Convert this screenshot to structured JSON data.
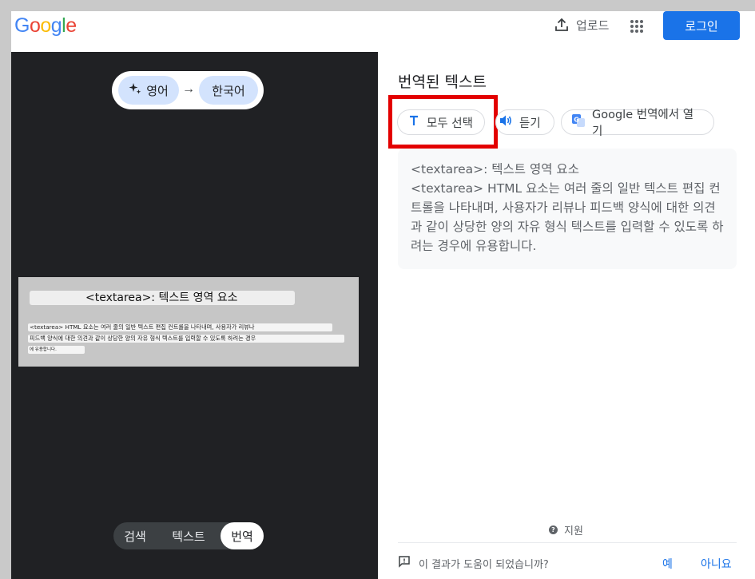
{
  "header": {
    "logo_letters": [
      "G",
      "o",
      "o",
      "g",
      "l",
      "e"
    ],
    "logo_colors": [
      "#4285F4",
      "#EA4335",
      "#FBBC05",
      "#4285F4",
      "#34A853",
      "#EA4335"
    ],
    "upload_label": "업로드",
    "upload_icon": "upload-icon",
    "apps_icon": "apps-grid-icon",
    "login_label": "로그인"
  },
  "left_panel": {
    "source_language": "영어",
    "target_language": "한국어",
    "swap_arrow": "→",
    "source_icon": "sparkle-icon",
    "preview": {
      "title_text": "<textarea>: 텍스트 영역 요소",
      "body_lines": [
        "<textarea> HTML 요소는 여러 줄의 일반 텍스트 편집 컨트롤을 나타내며, 사용자가 리뷰나",
        "피드백 양식에 대한 의견과 같이 상당한 양의 자유 형식 텍스트를 입력할 수 있도록 하려는 경우",
        "에 유용합니다."
      ]
    },
    "modes": [
      "검색",
      "텍스트",
      "번역"
    ],
    "active_mode": "번역"
  },
  "right_panel": {
    "title": "번역된 텍스트",
    "select_all_label": "모두 선택",
    "listen_label": "듣기",
    "open_in_translate_label": "Google 번역에서 열기",
    "highlight_color": "#e30000",
    "result_lines": [
      "<textarea>: 텍스트 영역 요소",
      "<textarea> HTML 요소는 여러 줄의 일반 텍스트 편집 컨트롤을 나타내며, 사용자가 리뷰나 피드백 양식에 대한 의견과 같이 상당한 양의 자유 형식 텍스트를 입력할 수 있도록 하려는 경우에 유용합니다."
    ],
    "support_label": "지원",
    "feedback_question": "이 결과가 도움이 되었습니까?",
    "yes_label": "예",
    "no_label": "아니요"
  }
}
